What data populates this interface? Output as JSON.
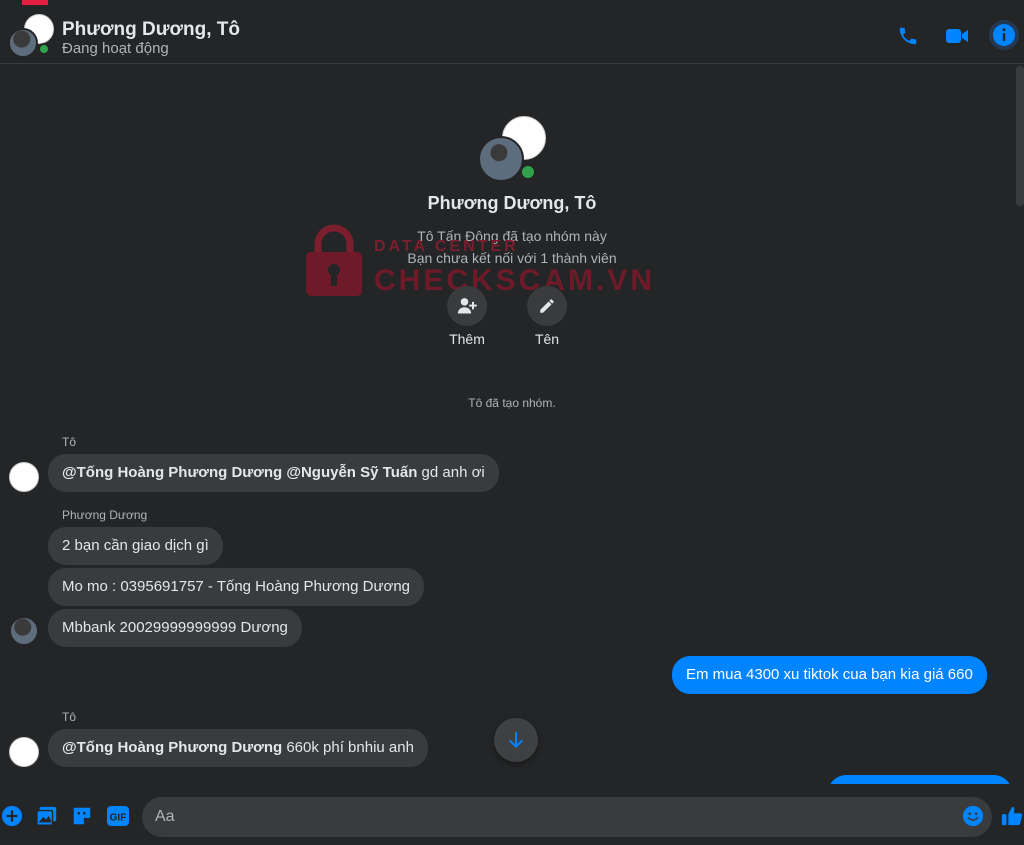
{
  "header": {
    "name": "Phương Dương, Tô",
    "status": "Đang hoạt động"
  },
  "profile": {
    "name": "Phương Dương, Tô",
    "created_by": "Tô Tấn Đông đã tạo nhóm này",
    "connection": "Bạn chưa kết nối với 1 thành viên",
    "add_label": "Thêm",
    "name_label": "Tên"
  },
  "watermark": {
    "small": "DATA CENTER",
    "big": "CHECKSCAM.VN"
  },
  "system_message": "Tô đã tạo nhóm.",
  "messages": {
    "m1_sender": "Tô",
    "m1_mention1": "@Tống Hoàng Phương Dương",
    "m1_mention2": "@Nguyễn Sỹ Tuấn",
    "m1_text": " gd anh ơi",
    "m2_sender": "Phương Dương",
    "m2_text": "2 bạn cần giao dịch gì",
    "m3_text": "Mo mo :   0395691757 - Tống Hoàng Phương Dương",
    "m4_text": "Mbbank 20029999999999 Dương",
    "m5_text": "Em mua 4300 xu tiktok cua bạn kia giá 660",
    "m6_sender": "Tô",
    "m6_mention": "@Tống Hoàng Phương Dương",
    "m6_text": " 660k phí bnhiu anh"
  },
  "composer": {
    "placeholder": "Aa"
  },
  "colors": {
    "accent": "#0084ff",
    "online": "#31a24c",
    "background": "#242526",
    "bubble": "#3a3b3c"
  },
  "icons": [
    "phone-icon",
    "video-icon",
    "info-icon",
    "add-person-icon",
    "pencil-icon",
    "arrow-down-icon",
    "plus-icon",
    "image-icon",
    "sticker-icon",
    "gif-icon",
    "emoji-icon",
    "like-icon"
  ]
}
